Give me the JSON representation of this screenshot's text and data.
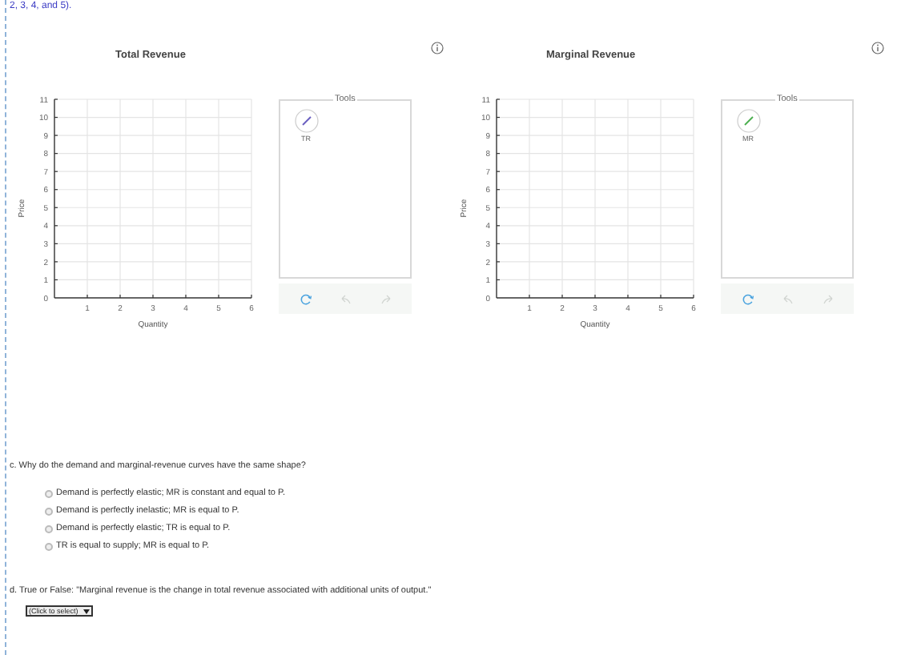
{
  "intro_text": "2, 3, 4, and 5).",
  "graphs": [
    {
      "tools_label": "Tools",
      "tool": {
        "label": "TR",
        "color": "#6a5fc0"
      },
      "chart_data": {
        "type": "line",
        "title": "Total Revenue",
        "grid": true,
        "xlabel": "Quantity",
        "ylabel": "Price",
        "xlim": [
          0,
          6
        ],
        "ylim": [
          0,
          11
        ],
        "xticks": [
          1,
          2,
          3,
          4,
          5,
          6
        ],
        "yticks": [
          0,
          1,
          2,
          3,
          4,
          5,
          6,
          7,
          8,
          9,
          10,
          11
        ]
      }
    },
    {
      "tools_label": "Tools",
      "tool": {
        "label": "MR",
        "color": "#4caf50"
      },
      "chart_data": {
        "type": "line",
        "title": "Marginal Revenue",
        "grid": true,
        "xlabel": "Quantity",
        "ylabel": "Price",
        "xlim": [
          0,
          6
        ],
        "ylim": [
          0,
          11
        ],
        "xticks": [
          1,
          2,
          3,
          4,
          5,
          6
        ],
        "yticks": [
          0,
          1,
          2,
          3,
          4,
          5,
          6,
          7,
          8,
          9,
          10,
          11
        ]
      }
    }
  ],
  "question_c": {
    "prompt": "c. Why do the demand and marginal-revenue curves have the same shape?",
    "options": [
      {
        "label": "Demand is perfectly elastic; MR is constant and equal to P.",
        "selected": false
      },
      {
        "label": "Demand is perfectly inelastic; MR is equal to P.",
        "selected": false
      },
      {
        "label": "Demand is perfectly elastic; TR is equal to P.",
        "selected": false
      },
      {
        "label": "TR is equal to supply; MR is equal to P.",
        "selected": false
      }
    ]
  },
  "question_d": {
    "prompt": "d. True or False: \"Marginal revenue is the change in total revenue associated with additional units of output.\"",
    "select": {
      "value": "(Click to select)"
    }
  }
}
